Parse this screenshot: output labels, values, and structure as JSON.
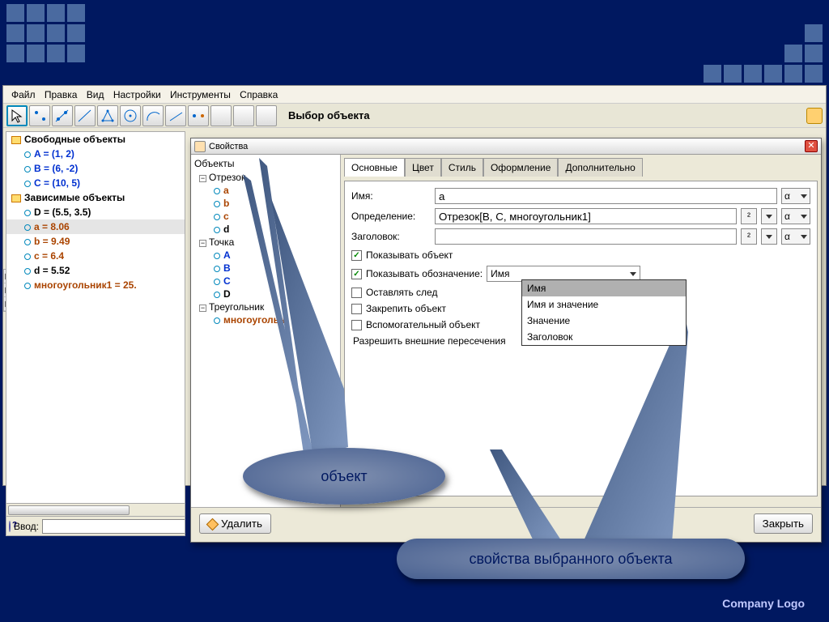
{
  "menubar": [
    "Файл",
    "Правка",
    "Вид",
    "Настройки",
    "Инструменты",
    "Справка"
  ],
  "toolbar": {
    "object_select_label": "Выбор объекта"
  },
  "tree_free_title": "Свободные объекты",
  "free_objs": [
    "A = (1, 2)",
    "B = (6, -2)",
    "C = (10, 5)"
  ],
  "tree_dep_title": "Зависимые объекты",
  "dep_objs": [
    {
      "text": "D = (5.5, 3.5)",
      "cls": "obj-black"
    },
    {
      "text": "a = 8.06",
      "cls": "obj-brown",
      "hl": true
    },
    {
      "text": "b = 9.49",
      "cls": "obj-brown"
    },
    {
      "text": "c = 6.4",
      "cls": "obj-brown"
    },
    {
      "text": "d = 5.52",
      "cls": "obj-black"
    },
    {
      "text": "многоугольник1 = 25.",
      "cls": "obj-brown"
    }
  ],
  "input_label": "Ввод:",
  "dialog": {
    "title": "Свойства",
    "objects_title": "Объекты",
    "groups": [
      {
        "name": "Отрезок",
        "items": [
          {
            "t": "a",
            "cls": "obj-brown"
          },
          {
            "t": "b",
            "cls": "obj-brown"
          },
          {
            "t": "c",
            "cls": "obj-brown"
          },
          {
            "t": "d",
            "cls": "obj-black"
          }
        ]
      },
      {
        "name": "Точка",
        "items": [
          {
            "t": "A",
            "cls": "obj-blue"
          },
          {
            "t": "B",
            "cls": "obj-blue"
          },
          {
            "t": "C",
            "cls": "obj-blue"
          },
          {
            "t": "D",
            "cls": "obj-black"
          }
        ]
      },
      {
        "name": "Треугольник",
        "items": [
          {
            "t": "многоугольн",
            "cls": "obj-brown"
          }
        ]
      }
    ],
    "tabs": [
      "Основные",
      "Цвет",
      "Стиль",
      "Оформление",
      "Дополнительно"
    ],
    "labels": {
      "name": "Имя:",
      "def": "Определение:",
      "caption": "Заголовок:",
      "show_obj": "Показывать объект",
      "show_label": "Показывать обозначение:",
      "trace": "Оставлять след",
      "fix": "Закрепить объект",
      "aux": "Вспомогательный объект",
      "allow": "Разрешить внешние пересечения"
    },
    "values": {
      "name": "a",
      "def": "Отрезок[B, C, многоугольник1]",
      "caption": "",
      "label_dd_selected": "Имя",
      "small_alpha": "α",
      "small_super": "²"
    },
    "dd_options": [
      "Имя",
      "Имя и значение",
      "Значение",
      "Заголовок"
    ],
    "delete_btn": "Удалить",
    "close_btn": "Закрыть"
  },
  "callouts": {
    "c1": "объект",
    "c2": "свойства выбранного объекта"
  },
  "footer": "Company  Logo"
}
